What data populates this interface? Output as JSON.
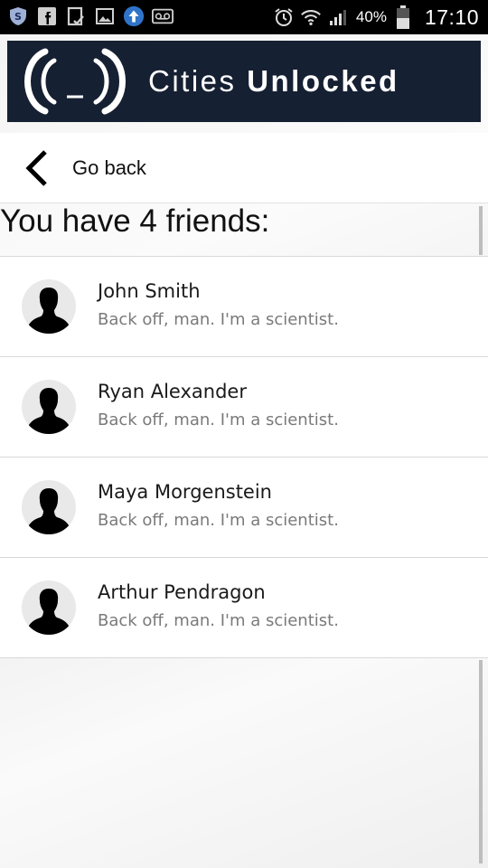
{
  "status_bar": {
    "icons_left": [
      "shield-icon",
      "facebook-icon",
      "clipboard-check-icon",
      "image-icon",
      "upload-icon",
      "voicemail-icon"
    ],
    "icons_right": [
      "alarm-icon",
      "wifi-icon",
      "signal-icon",
      "battery-icon"
    ],
    "battery": "40%",
    "time": "17:10"
  },
  "banner": {
    "brand_light": "Cities ",
    "brand_bold": "Unlocked",
    "colors": {
      "background": "#162033",
      "text": "#ffffff"
    }
  },
  "nav": {
    "back_label": "Go back"
  },
  "friends": {
    "heading": "You have 4 friends:",
    "items": [
      {
        "name": "John Smith",
        "status": "Back off, man. I'm a scientist."
      },
      {
        "name": "Ryan Alexander",
        "status": "Back off, man. I'm a scientist."
      },
      {
        "name": "Maya Morgenstein",
        "status": "Back off, man. I'm a scientist."
      },
      {
        "name": "Arthur Pendragon",
        "status": "Back off, man. I'm a scientist."
      }
    ]
  }
}
